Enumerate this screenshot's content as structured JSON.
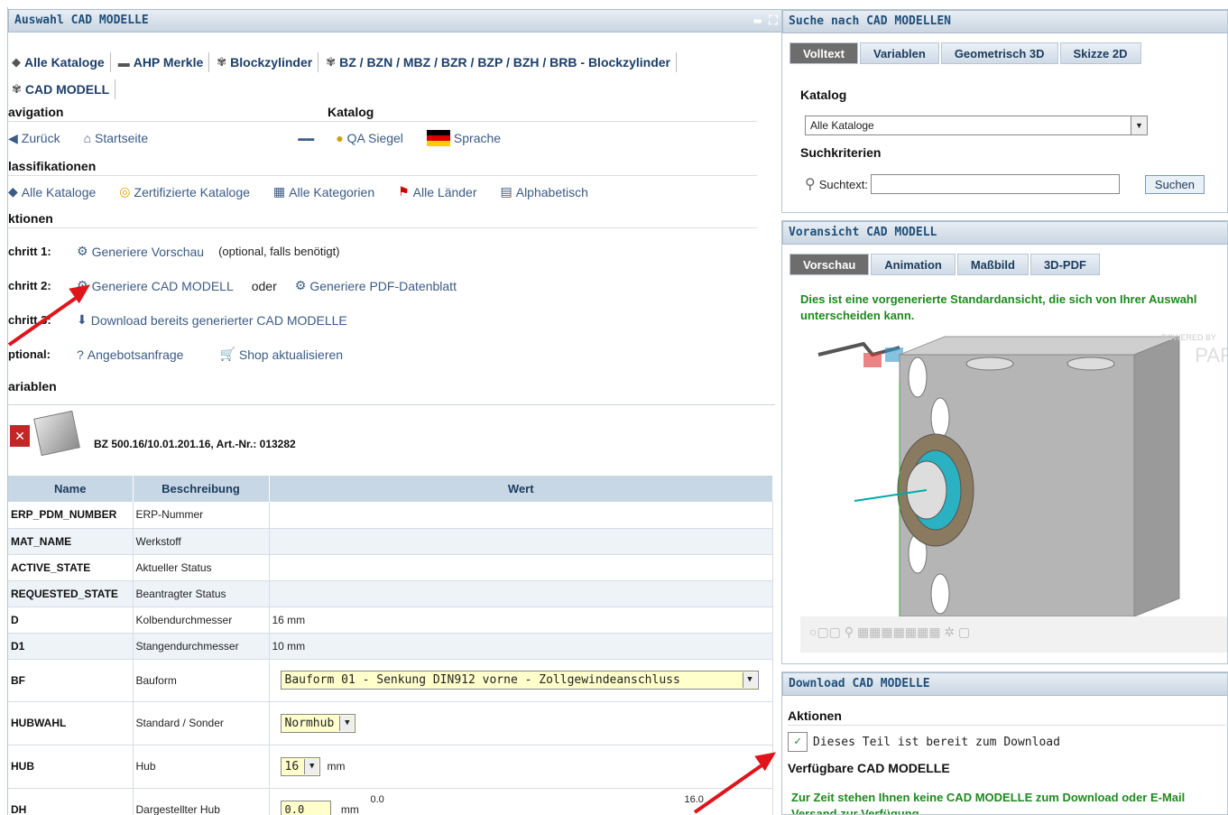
{
  "left": {
    "title": "Auswahl CAD MODELLE",
    "breadcrumbs": [
      "Alle Kataloge",
      "AHP Merkle",
      "Blockzylinder",
      "BZ / BZN / MBZ / BZR / BZP / BZH / BRB - Blockzylinder",
      "CAD MODELL"
    ],
    "navigation": {
      "heading": "avigation",
      "back": "Zurück",
      "home": "Startseite"
    },
    "katalog": {
      "heading": "Katalog",
      "qa": "QA Siegel",
      "language": "Sprache"
    },
    "klassifikationen": {
      "heading": "lassifikationen",
      "items": [
        "Alle Kataloge",
        "Zertifizierte Kataloge",
        "Alle Kategorien",
        "Alle Länder",
        "Alphabetisch"
      ]
    },
    "aktionen": {
      "heading": "ktionen",
      "step1_label": "chritt 1:",
      "step1_link": "Generiere Vorschau",
      "step1_note": "(optional, falls benötigt)",
      "step2_label": "chritt 2:",
      "step2_link": "Generiere CAD MODELL",
      "step2_or": "oder",
      "step2_link2": "Generiere PDF-Datenblatt",
      "step3_label": "chritt 3:",
      "step3_link": "Download bereits generierter CAD MODELLE",
      "optional_label": "ptional:",
      "opt_link1": "Angebotsanfrage",
      "opt_link2": "Shop aktualisieren"
    },
    "variablen": {
      "heading": "ariablen",
      "part_title": "BZ 500.16/10.01.201.16, Art.-Nr.: 013282",
      "columns": [
        "Name",
        "Beschreibung",
        "Wert"
      ],
      "rows": [
        {
          "name": "ERP_PDM_NUMBER",
          "desc": "ERP-Nummer",
          "value": ""
        },
        {
          "name": "MAT_NAME",
          "desc": "Werkstoff",
          "value": ""
        },
        {
          "name": "ACTIVE_STATE",
          "desc": "Aktueller Status",
          "value": ""
        },
        {
          "name": "REQUESTED_STATE",
          "desc": "Beantragter Status",
          "value": ""
        },
        {
          "name": "D",
          "desc": "Kolbendurchmesser",
          "value": "16 mm"
        },
        {
          "name": "D1",
          "desc": "Stangendurchmesser",
          "value": "10 mm"
        }
      ],
      "bf": {
        "name": "BF",
        "desc": "Bauform",
        "value": "Bauform 01 - Senkung DIN912 vorne - Zollgewindeanschluss"
      },
      "hubwahl": {
        "name": "HUBWAHL",
        "desc": "Standard / Sonder",
        "value": "Normhub"
      },
      "hub": {
        "name": "HUB",
        "desc": "Hub",
        "value": "16",
        "unit": "mm"
      },
      "dh": {
        "name": "DH",
        "desc": "Dargestellter Hub",
        "value": "0.0",
        "unit": "mm",
        "min": "0.0",
        "max": "16.0"
      }
    }
  },
  "search": {
    "title": "Suche nach CAD MODELLEN",
    "tabs": [
      "Volltext",
      "Variablen",
      "Geometrisch 3D",
      "Skizze 2D"
    ],
    "katalog_label": "Katalog",
    "katalog_value": "Alle Kataloge",
    "criteria_label": "Suchkriterien",
    "suchtext_label": "Suchtext:",
    "search_button": "Suchen"
  },
  "preview": {
    "title": "Voransicht CAD MODELL",
    "tabs": [
      "Vorschau",
      "Animation",
      "Maßbild",
      "3D-PDF"
    ],
    "note": "Dies ist eine vorgenerierte Standardansicht, die sich von Ihrer Auswahl unterscheiden kann.",
    "watermark": "POWERED BY",
    "watermark2": "PAR"
  },
  "download": {
    "title": "Download CAD MODELLE",
    "actions_label": "Aktionen",
    "ready_text": "Dieses Teil ist bereit zum Download",
    "available_label": "Verfügbare CAD MODELLE",
    "message": "Zur Zeit stehen Ihnen keine CAD MODELLE zum Download oder E-Mail Versand zur Verfügung"
  },
  "colors": {
    "accent": "#1f4f7a",
    "green": "#1e8a1e",
    "arrow": "#e0141a"
  }
}
